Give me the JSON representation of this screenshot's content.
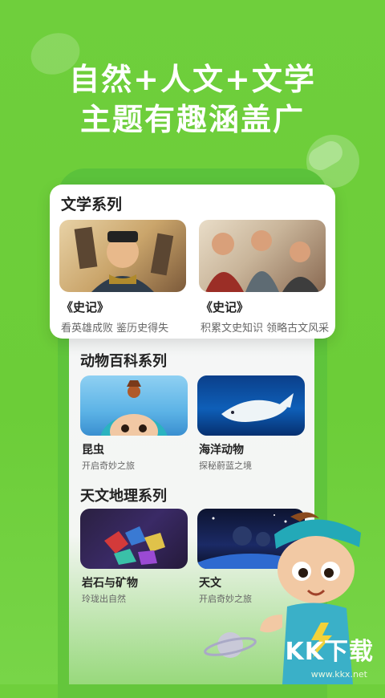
{
  "headline": {
    "line1": "自然+人文+文学",
    "line2": "主题有趣涵盖广"
  },
  "literature_series": {
    "title": "文学系列",
    "items": [
      {
        "title": "《史记》",
        "subtitle": "看英雄成败 鉴历史得失"
      },
      {
        "title": "《史记》",
        "subtitle": "积累文史知识 领略古文风采"
      }
    ]
  },
  "animal_series": {
    "title": "动物百科系列",
    "items": [
      {
        "title": "昆虫",
        "subtitle": "开启奇妙之旅"
      },
      {
        "title": "海洋动物",
        "subtitle": "探秘蔚蓝之境"
      }
    ]
  },
  "geo_series": {
    "title": "天文地理系列",
    "items": [
      {
        "title": "岩石与矿物",
        "subtitle": "玲珑出自然"
      },
      {
        "title": "天文",
        "subtitle": "开启奇妙之旅"
      }
    ]
  },
  "watermark": {
    "logo": "KK下载",
    "url": "www.kkx.net"
  }
}
